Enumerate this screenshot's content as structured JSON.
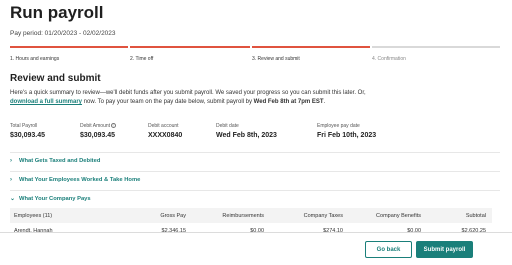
{
  "page": {
    "title": "Run payroll",
    "pay_period": "Pay period: 01/20/2023 - 02/02/2023"
  },
  "steps": [
    {
      "label": "1. Hours and earnings",
      "state": "done"
    },
    {
      "label": "2. Time off",
      "state": "done"
    },
    {
      "label": "3. Review and submit",
      "state": "done"
    },
    {
      "label": "4. Confirmation",
      "state": "upcoming"
    }
  ],
  "review": {
    "title": "Review and submit",
    "intro_1": "Here's a quick summary to review—we'll debit funds after you submit payroll. We saved your progress so you can submit this later. Or,",
    "download_link": "download a full summary",
    "intro_2": " now. To pay your team on the pay date below, submit payroll by ",
    "deadline": "Wed Feb 8th at 7pm EST",
    "intro_end": "."
  },
  "summary": [
    {
      "label": "Total Payroll",
      "value": "$30,093.45"
    },
    {
      "label": "Debit Amount",
      "value": "$30,093.45",
      "info_icon": "ⓘ"
    },
    {
      "label": "Debit account",
      "value": "XXXX0840"
    },
    {
      "label": "Debit date",
      "value": "Wed Feb 8th, 2023"
    },
    {
      "label": "Employee pay date",
      "value": "Fri Feb 10th, 2023"
    }
  ],
  "accordions": [
    {
      "label": "What Gets Taxed and Debited",
      "chevron": "›",
      "expanded": false
    },
    {
      "label": "What Your Employees Worked & Take Home",
      "chevron": "›",
      "expanded": false
    },
    {
      "label": "What Your Company Pays",
      "chevron": "⌄",
      "expanded": true
    }
  ],
  "table": {
    "headers": [
      "Employees (11)",
      "Gross Pay",
      "Reimbursements",
      "Company Taxes",
      "Company Benefits",
      "Subtotal"
    ],
    "rows": [
      [
        "Arendt, Hannah",
        "$2,346.15",
        "$0.00",
        "$274.10",
        "$0.00",
        "$2,620.25"
      ]
    ]
  },
  "footer": {
    "back_label": "Go back",
    "submit_label": "Submit payroll"
  },
  "colors": {
    "accent": "#1a7f7a",
    "progress": "#e0533f"
  }
}
